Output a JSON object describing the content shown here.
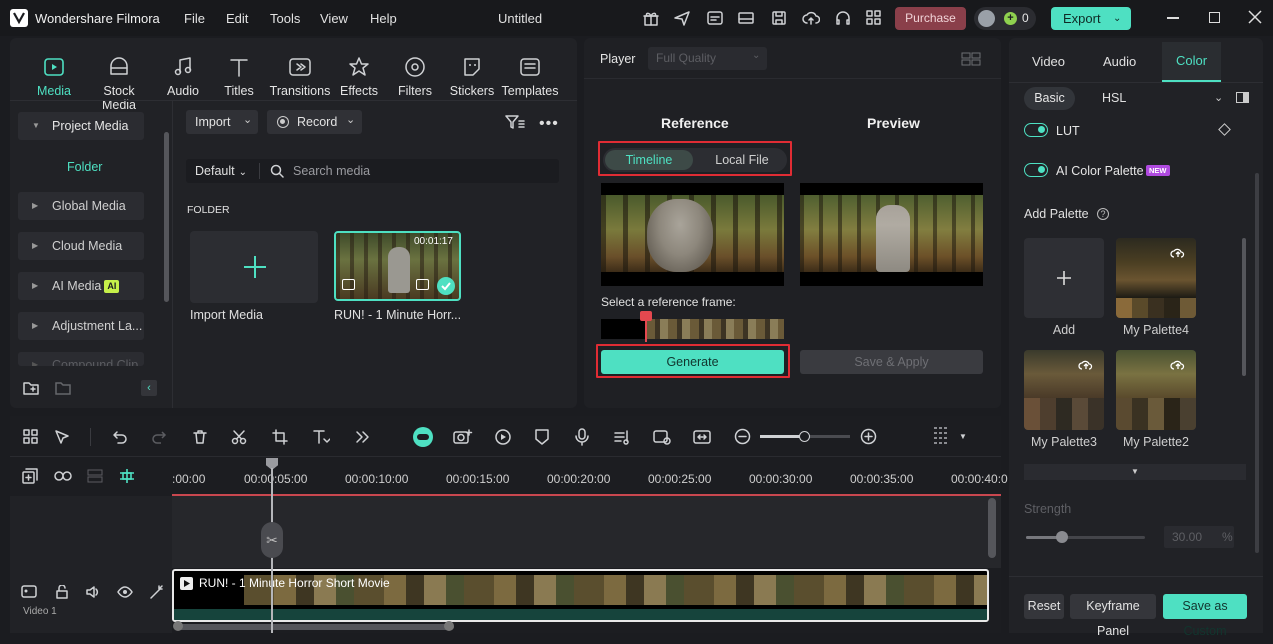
{
  "app": {
    "name": "Wondershare Filmora",
    "menu": [
      "File",
      "Edit",
      "Tools",
      "View",
      "Help"
    ],
    "project_title": "Untitled",
    "credits": "0",
    "purchase_label": "Purchase",
    "export_label": "Export"
  },
  "colors": {
    "accent": "#4ee0c2",
    "highlight": "#e02c34",
    "purchase": "#8a3f4a",
    "panel": "#212226"
  },
  "media_tabs": [
    {
      "label": "Media",
      "icon": "media-icon",
      "active": true
    },
    {
      "label": "Stock Media",
      "icon": "stock-media-icon"
    },
    {
      "label": "Audio",
      "icon": "audio-icon"
    },
    {
      "label": "Titles",
      "icon": "titles-icon"
    },
    {
      "label": "Transitions",
      "icon": "transitions-icon"
    },
    {
      "label": "Effects",
      "icon": "effects-icon"
    },
    {
      "label": "Filters",
      "icon": "filters-icon"
    },
    {
      "label": "Stickers",
      "icon": "stickers-icon"
    },
    {
      "label": "Templates",
      "icon": "templates-icon"
    }
  ],
  "sidebar": {
    "items": [
      "Project Media",
      "Folder",
      "Global Media",
      "Cloud Media",
      "AI Media",
      "Adjustment La...",
      "Compound Clip"
    ],
    "ai_badge": "AI"
  },
  "media_toolbar": {
    "import_label": "Import",
    "record_label": "Record",
    "sort_label": "Default",
    "search_placeholder": "Search media",
    "folder_heading": "FOLDER"
  },
  "media_items": [
    {
      "label": "Import Media"
    },
    {
      "label": "RUN! - 1 Minute Horr...",
      "duration": "00:01:17"
    }
  ],
  "player": {
    "label": "Player",
    "quality": "Full Quality",
    "reference_heading": "Reference",
    "preview_heading": "Preview",
    "source_tabs": [
      "Timeline",
      "Local File"
    ],
    "active_source": "Timeline",
    "select_frame_label": "Select a reference frame:",
    "generate_label": "Generate",
    "save_apply_label": "Save & Apply"
  },
  "color_panel": {
    "tabs": [
      "Video",
      "Audio",
      "Color"
    ],
    "active_tab": "Color",
    "subtabs": [
      "Basic",
      "HSL"
    ],
    "active_subtab": "Basic",
    "lut_label": "LUT",
    "ai_palette_label": "AI Color Palette",
    "new_badge": "NEW",
    "add_palette_label": "Add Palette",
    "palettes": [
      "Add",
      "My Palette4",
      "My Palette3",
      "My Palette2"
    ],
    "strength_label": "Strength",
    "strength_value": "30.00",
    "strength_unit": "%",
    "strength_fraction": 0.3,
    "buttons": [
      "Reset",
      "Keyframe Panel",
      "Save as Custom"
    ]
  },
  "timeline": {
    "ticks": [
      ":00:00",
      "00:00:05:00",
      "00:00:10:00",
      "00:00:15:00",
      "00:00:20:00",
      "00:00:25:00",
      "00:00:30:00",
      "00:00:35:00",
      "00:00:40:0"
    ],
    "clip_title": "RUN! - 1 Minute Horror Short Movie",
    "track_label": "Video 1"
  }
}
